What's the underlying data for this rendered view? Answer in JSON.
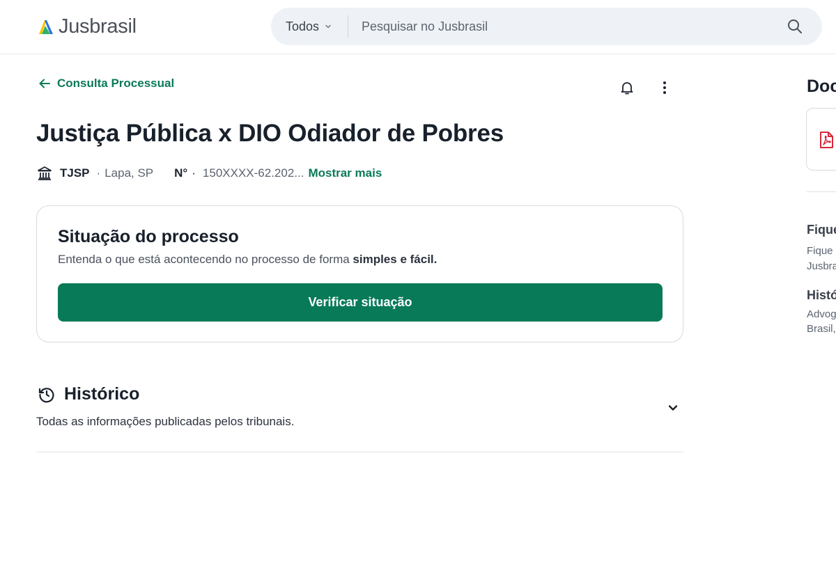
{
  "header": {
    "logo_text": "Jusbrasil",
    "search": {
      "scope_label": "Todos",
      "placeholder": "Pesquisar no Jusbrasil",
      "value": ""
    }
  },
  "nav": {
    "back_label": "Consulta Processual"
  },
  "process": {
    "title": "Justiça Pública x DIO Odiador de Pobres",
    "court": "TJSP",
    "separator": "·",
    "location": "Lapa, SP",
    "number_label": "N°",
    "number_separator": "·",
    "number": "150XXXX-62.202...",
    "show_more_label": "Mostrar mais"
  },
  "situation_card": {
    "title": "Situação do processo",
    "subtitle_prefix": "Entenda o que está acontecendo no processo de forma ",
    "subtitle_bold": "simples e fácil.",
    "button_label": "Verificar situação"
  },
  "history": {
    "title": "Histórico",
    "subtitle": "Todas as informações publicadas pelos tribunais."
  },
  "sidebar": {
    "title": "Doc",
    "section1_title": "Fique",
    "section1_line1": "Fique",
    "section1_line2": "Jusbra",
    "section2_title": "Histó",
    "section2_line1": "Advog",
    "section2_line2": "Brasil,"
  },
  "colors": {
    "brand_green": "#087a58",
    "link_green": "#0b7a58",
    "logo_yellow": "#f5c400",
    "logo_blue": "#2a74d9",
    "logo_green": "#2fb26b",
    "pdf_red": "#d6283b"
  },
  "icons": {
    "logo": "jusbrasil-logo-icon",
    "scope_dropdown": "chevron-down-icon",
    "search": "search-icon",
    "back": "arrow-left-icon",
    "notification": "bell-icon",
    "more": "more-vertical-icon",
    "court": "courthouse-icon",
    "history": "history-clock-icon",
    "expand": "chevron-down-icon",
    "document": "pdf-icon"
  }
}
